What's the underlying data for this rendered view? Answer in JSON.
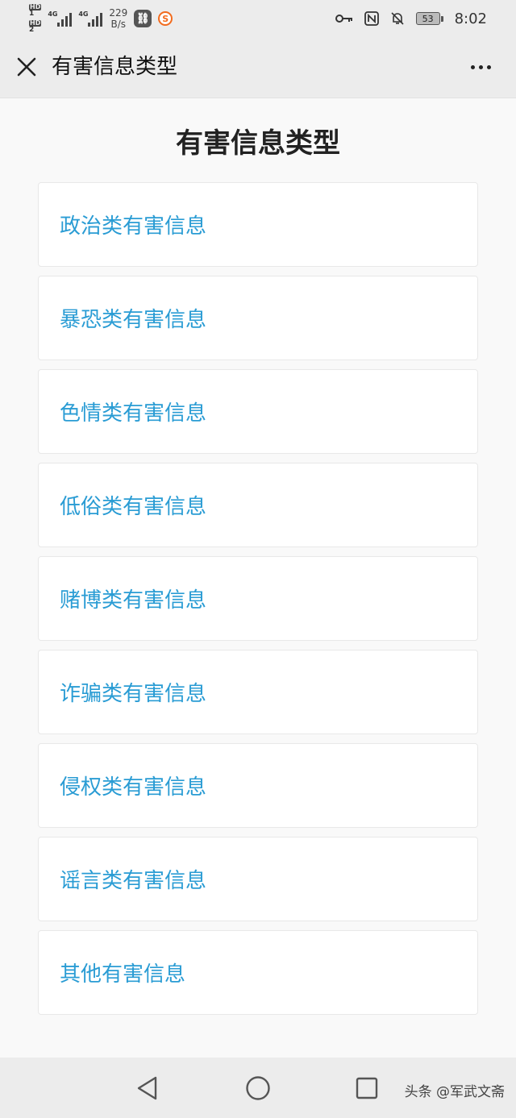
{
  "status_bar": {
    "hd1": "HD",
    "hd1_sub": "1",
    "hd2": "HD",
    "hd2_sub": "2",
    "signal1_label": "4G",
    "signal2_label": "4G",
    "speed_value": "229",
    "speed_unit": "B/s",
    "battery_level": "53",
    "time": "8:02"
  },
  "nav": {
    "title": "有害信息类型"
  },
  "main": {
    "title": "有害信息类型",
    "items": [
      {
        "label": "政治类有害信息"
      },
      {
        "label": "暴恐类有害信息"
      },
      {
        "label": "色情类有害信息"
      },
      {
        "label": "低俗类有害信息"
      },
      {
        "label": "赌博类有害信息"
      },
      {
        "label": "诈骗类有害信息"
      },
      {
        "label": "侵权类有害信息"
      },
      {
        "label": "谣言类有害信息"
      },
      {
        "label": "其他有害信息"
      }
    ]
  },
  "watermark": "头条 @军武文斋",
  "colors": {
    "link": "#2a9cd4",
    "bar_bg": "#ececec"
  }
}
